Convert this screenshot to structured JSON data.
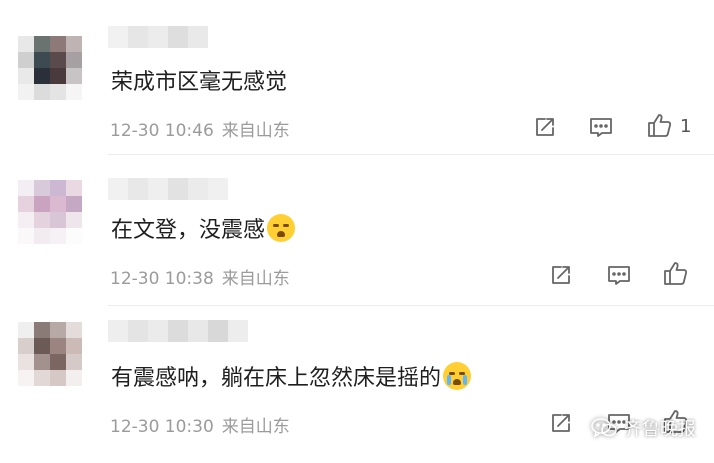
{
  "comments": [
    {
      "text": "荣成市区毫无感觉",
      "time": "12-30 10:46",
      "location": "来自山东",
      "like_count": "1",
      "emoji": ""
    },
    {
      "text": "在文登，没震感",
      "time": "12-30 10:38",
      "location": "来自山东",
      "like_count": "",
      "emoji": "covering-eyes-face"
    },
    {
      "text": "有震感呐，躺在床上忽然床是摇的",
      "time": "12-30 10:30",
      "location": "来自山东",
      "like_count": "",
      "emoji": "crying-face"
    }
  ],
  "icons": {
    "reply": "reply-icon",
    "comment": "comment-icon",
    "like": "thumbs-up-icon"
  },
  "watermark": {
    "text": "齐鲁晚报",
    "icon": "wechat-icon"
  }
}
